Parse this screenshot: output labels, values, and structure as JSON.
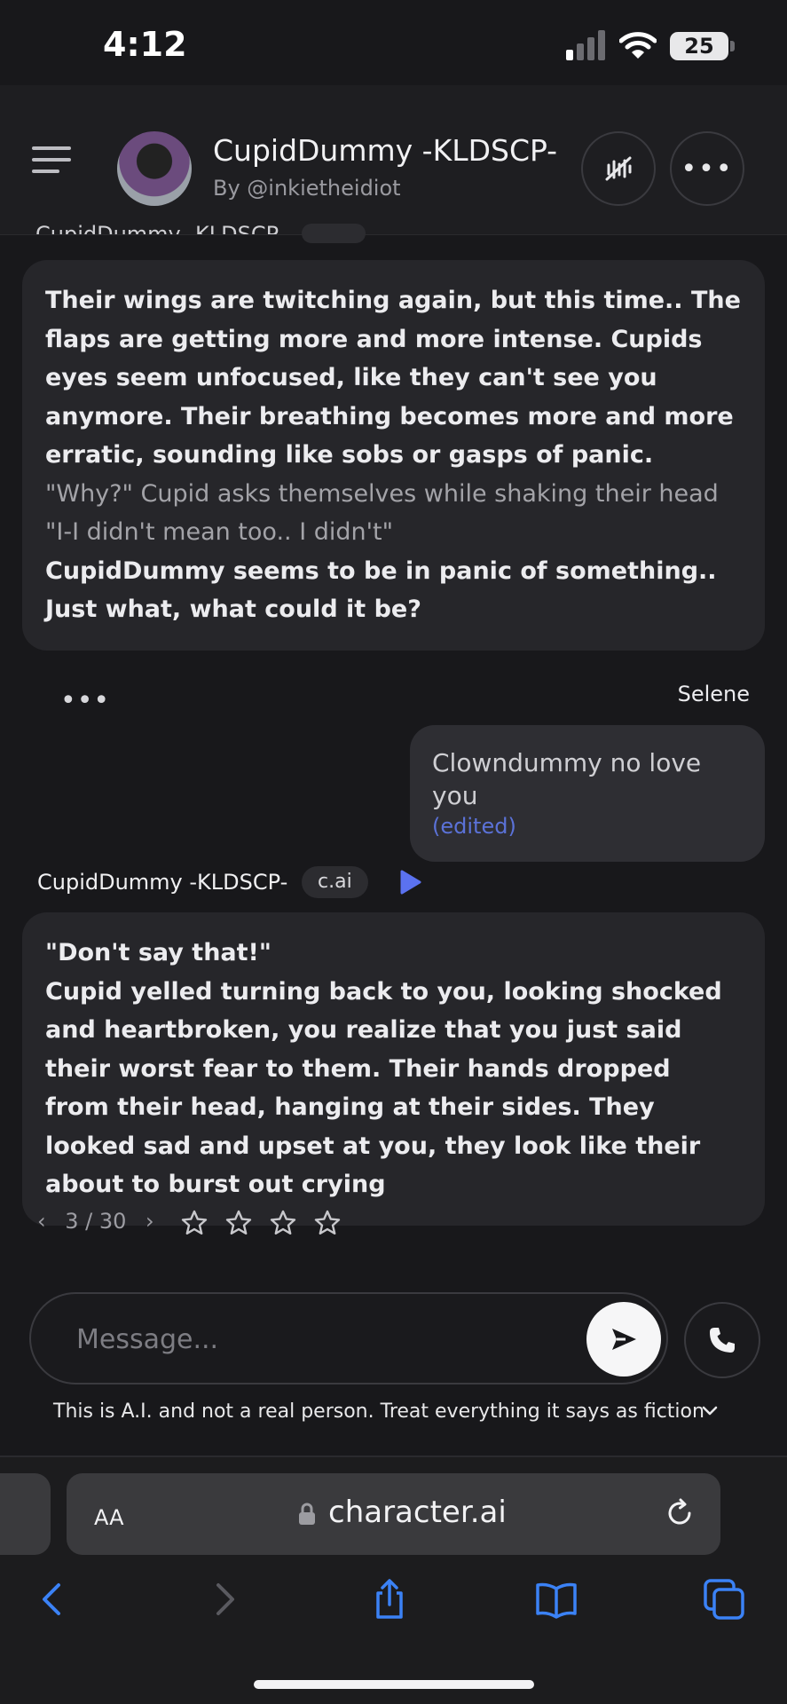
{
  "status_bar": {
    "time": "4:12",
    "battery": "25"
  },
  "header": {
    "character_name": "CupidDummy -KLDSCP-",
    "creator": "By @inkietheidiot",
    "buttons": [
      "mute-voice",
      "more-options"
    ]
  },
  "chat": {
    "clipped_top_label": "CupidDummy -KLDSCP-",
    "message1": {
      "lines": [
        {
          "style": "bold",
          "text": "Their wings are twitching again, but this time.. The flaps are getting more and more intense. Cupids eyes seem unfocused, like they can't see you anymore. Their breathing becomes more and more erratic, sounding like sobs or gasps of panic."
        },
        {
          "style": "dim",
          "text": "\"Why?\" Cupid asks themselves while shaking their head \"I-I didn't mean too.. I didn't\""
        },
        {
          "style": "bold",
          "text": "CupidDummy seems to be in panic of something.. Just what, what could it be?"
        }
      ]
    },
    "dots": "•••",
    "user": {
      "name": "Selene",
      "message": "Clowndummy no love you",
      "edited": "(edited)"
    },
    "message2": {
      "author": "CupidDummy -KLDSCP-",
      "badge": "c.ai",
      "lines": [
        {
          "style": "bold",
          "text": "\"Don't say that!\""
        },
        {
          "style": "bold",
          "text": "Cupid yelled turning back to you, looking shocked and heartbroken, you realize that you just said their worst fear to them. Their hands dropped from their head, hanging at their sides. They looked sad and upset at you, they look like their about to burst out crying"
        }
      ]
    },
    "pager": {
      "current": "3",
      "total": "30",
      "label": "3 / 30"
    },
    "rating": {
      "stars": 4,
      "filled": 0
    }
  },
  "composer": {
    "placeholder": "Message...",
    "disclaimer": "This is A.I. and not a real person. Treat everything it says as fiction"
  },
  "browser": {
    "text_size": "AA",
    "url": "character.ai",
    "toolbar": [
      "back",
      "forward",
      "share",
      "bookmarks",
      "tabs"
    ]
  },
  "colors": {
    "accent": "#5b72d8",
    "background": "#18181b",
    "bubble": "#26262a"
  }
}
